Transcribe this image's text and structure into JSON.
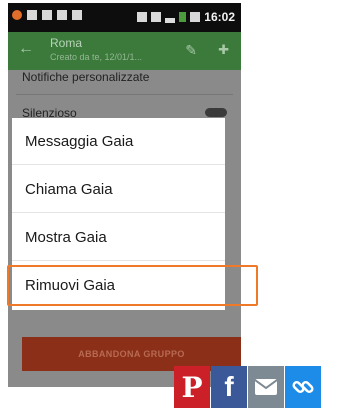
{
  "status_bar": {
    "time": "16:02"
  },
  "app_bar": {
    "title": "Roma",
    "subtitle": "Creato da te, 12/01/1..."
  },
  "settings": {
    "notifications_label": "Notifiche personalizzate",
    "silent_label": "Silenzioso"
  },
  "dialog": {
    "items": [
      {
        "label": "Messaggia Gaia"
      },
      {
        "label": "Chiama Gaia"
      },
      {
        "label": "Mostra Gaia"
      },
      {
        "label": "Rimuovi Gaia"
      }
    ]
  },
  "leave_button": {
    "label": "ABBANDONA GRUPPO"
  },
  "share": {
    "pinterest_glyph": "P",
    "facebook_glyph": "f",
    "email_icon": "envelope",
    "link_icon": "chain-link"
  },
  "colors": {
    "appbar": "#3b7a3b",
    "highlight": "#ee7a29",
    "leave_button": "#8b2f19",
    "pinterest": "#cb2027",
    "facebook": "#3b5998",
    "email": "#7d8a93",
    "link": "#1c8ce8"
  }
}
